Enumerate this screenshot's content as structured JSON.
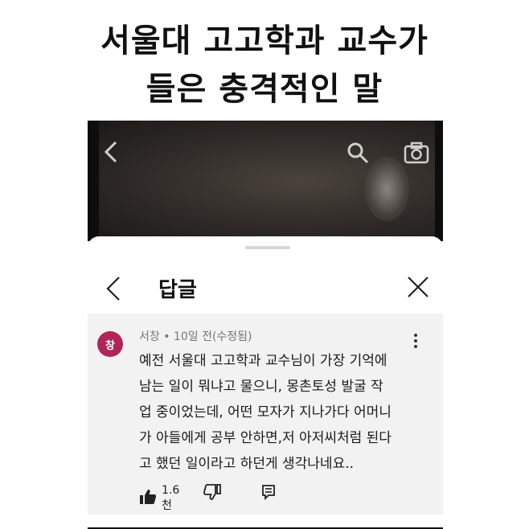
{
  "headline": {
    "line1": "서울대 고고학과 교수가",
    "line2": "들은 충격적인 말"
  },
  "sheet": {
    "title": "답글"
  },
  "comment": {
    "avatar_text": "창",
    "meta": "서창 • 10일 전(수정됨)",
    "lines": [
      "예전 서울대 고고학과 교수님이 가장 기억에",
      "남는 일이 뭐냐고 물으니, 몽촌토성 발굴 작",
      "업 중이었는데, 어떤 모자가 지나가다 어머니",
      "가 아들에게 공부 안하면,저 아저씨처럼 된다",
      "고 했던 일이라고 하던게 생각나네요.."
    ],
    "like_count": "1.6천"
  },
  "colors": {
    "avatar": "#b0245a",
    "card_background": "#f2f2f2",
    "video_background": "#2f2a27"
  },
  "icons": {
    "video": [
      "back-icon",
      "search-icon",
      "camera-icon"
    ],
    "header": [
      "back-icon",
      "close-icon"
    ],
    "comment": [
      "more-vert-icon",
      "thumbs-up-icon",
      "thumbs-down-icon",
      "reply-icon"
    ]
  }
}
